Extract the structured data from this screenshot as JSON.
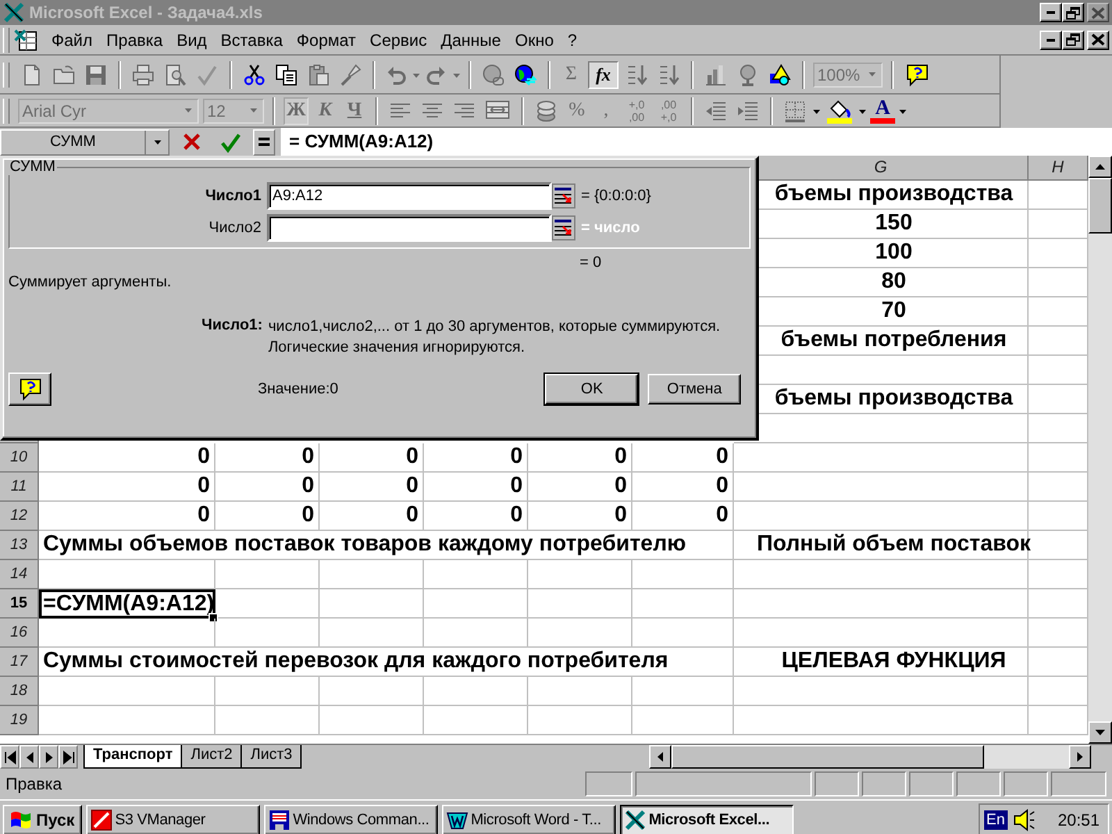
{
  "window": {
    "title": "Microsoft Excel - Задача4.xls",
    "active": false,
    "controls": [
      {
        "kind": "minimize",
        "disabled": false
      },
      {
        "kind": "restore",
        "disabled": false
      },
      {
        "kind": "close",
        "disabled": true
      }
    ]
  },
  "menu": {
    "items": [
      "Файл",
      "Правка",
      "Вид",
      "Вставка",
      "Формат",
      "Сервис",
      "Данные",
      "Окно",
      "?"
    ],
    "controls": [
      {
        "kind": "minimize",
        "disabled": false
      },
      {
        "kind": "restore",
        "disabled": false
      },
      {
        "kind": "close",
        "disabled": false
      }
    ]
  },
  "standard_toolbar": [
    {
      "kind": "new-document",
      "disabled": true
    },
    {
      "kind": "folder",
      "disabled": true
    },
    {
      "kind": "floppy-disk",
      "disabled": true
    },
    {
      "kind": "separator"
    },
    {
      "kind": "printer",
      "disabled": true
    },
    {
      "kind": "print-preview",
      "disabled": true
    },
    {
      "kind": "spellcheck",
      "disabled": true
    },
    {
      "kind": "separator"
    },
    {
      "kind": "scissors",
      "disabled": false
    },
    {
      "kind": "copy",
      "disabled": false
    },
    {
      "kind": "clipboard",
      "disabled": true
    },
    {
      "kind": "paintbrush",
      "disabled": true
    },
    {
      "kind": "separator"
    },
    {
      "kind": "undo",
      "disabled": true
    },
    {
      "kind": "caret",
      "disabled": true
    },
    {
      "kind": "redo",
      "disabled": true
    },
    {
      "kind": "caret",
      "disabled": true
    },
    {
      "kind": "separator"
    },
    {
      "kind": "globe-link",
      "disabled": true
    },
    {
      "kind": "globe",
      "disabled": false
    },
    {
      "kind": "separator"
    },
    {
      "kind": "text",
      "label": "Σ",
      "disabled": true
    },
    {
      "kind": "text",
      "label": "fx",
      "disabled": false,
      "pressed": true
    },
    {
      "kind": "sort-ascending",
      "disabled": true
    },
    {
      "kind": "sort-descending",
      "disabled": true
    },
    {
      "kind": "separator"
    },
    {
      "kind": "chart",
      "disabled": true
    },
    {
      "kind": "globe-stand",
      "disabled": true
    },
    {
      "kind": "drawing",
      "disabled": false
    },
    {
      "kind": "separator"
    },
    {
      "kind": "zoom",
      "value": "100%",
      "disabled": true
    },
    {
      "kind": "separator"
    },
    {
      "kind": "help",
      "disabled": false
    }
  ],
  "formatting_toolbar": [
    {
      "kind": "font-name",
      "value": "Arial Cyr",
      "disabled": true
    },
    {
      "kind": "font-size",
      "value": "12",
      "disabled": true
    },
    {
      "kind": "separator"
    },
    {
      "kind": "bold",
      "label": "Ж",
      "disabled": true,
      "pressed": true
    },
    {
      "kind": "italic",
      "label": "К",
      "disabled": true
    },
    {
      "kind": "underline",
      "label": "Ч",
      "disabled": true
    },
    {
      "kind": "separator"
    },
    {
      "kind": "align-left",
      "disabled": true
    },
    {
      "kind": "align-center",
      "disabled": true
    },
    {
      "kind": "align-right",
      "disabled": true
    },
    {
      "kind": "merge",
      "disabled": true
    },
    {
      "kind": "separator"
    },
    {
      "kind": "coins",
      "disabled": true
    },
    {
      "kind": "text",
      "label": "%",
      "disabled": true
    },
    {
      "kind": "text",
      "label": ",",
      "disabled": true
    },
    {
      "kind": "decimals",
      "lines": [
        "+,0",
        ",00"
      ],
      "disabled": true
    },
    {
      "kind": "decimals",
      "lines": [
        ",00",
        "+,0"
      ],
      "disabled": true
    },
    {
      "kind": "separator"
    },
    {
      "kind": "outdent",
      "disabled": true
    },
    {
      "kind": "indent",
      "disabled": true
    },
    {
      "kind": "separator"
    },
    {
      "kind": "borders",
      "disabled": true
    },
    {
      "kind": "caret",
      "disabled": false
    },
    {
      "kind": "fill-color",
      "disabled": false
    },
    {
      "kind": "caret",
      "disabled": false
    },
    {
      "kind": "font-color",
      "label": "A",
      "disabled": false
    },
    {
      "kind": "caret",
      "disabled": false
    }
  ],
  "formula_bar": {
    "name_box": "СУММ",
    "formula": "= СУММ(A9:A12)"
  },
  "sheet": {
    "columns": [
      "G",
      "H"
    ],
    "rows": [
      {
        "kind": "text",
        "cells": {
          "G": "бъемы производства"
        }
      },
      {
        "kind": "text",
        "cells": {
          "G": "150"
        }
      },
      {
        "kind": "text",
        "cells": {
          "G": "100"
        }
      },
      {
        "kind": "text",
        "cells": {
          "G": "80"
        }
      },
      {
        "kind": "text",
        "cells": {
          "G": "70"
        }
      },
      {
        "kind": "text",
        "cells": {
          "G": "бъемы потребления"
        }
      },
      {
        "kind": "blank"
      },
      {
        "kind": "text",
        "cells": {
          "G": "бъемы производства"
        }
      },
      {
        "kind": "blank"
      },
      {
        "header": "10",
        "kind": "numbers",
        "selected": false,
        "cells": {
          "A": "0",
          "B": "0",
          "C": "0",
          "D": "0",
          "E": "0",
          "F": "0"
        }
      },
      {
        "header": "11",
        "kind": "numbers",
        "selected": false,
        "cells": {
          "A": "0",
          "B": "0",
          "C": "0",
          "D": "0",
          "E": "0",
          "F": "0"
        }
      },
      {
        "header": "12",
        "kind": "numbers",
        "selected": false,
        "cells": {
          "A": "0",
          "B": "0",
          "C": "0",
          "D": "0",
          "E": "0",
          "F": "0"
        }
      },
      {
        "header": "13",
        "kind": "text",
        "selected": false,
        "cells": {
          "A": "Суммы объемов поставок товаров каждому потребителю",
          "G": "Полный объем поставок"
        }
      },
      {
        "header": "14",
        "kind": "blank",
        "selected": false
      },
      {
        "header": "15",
        "kind": "text",
        "selected": true,
        "cells": {
          "A": "=СУММ(A9:A12)"
        }
      },
      {
        "header": "16",
        "kind": "blank",
        "selected": false
      },
      {
        "header": "17",
        "kind": "text",
        "selected": false,
        "cells": {
          "A": "Суммы стоимостей перевозок для каждого потребителя",
          "G": "ЦЕЛЕВАЯ ФУНКЦИЯ"
        }
      },
      {
        "header": "18",
        "kind": "blank",
        "selected": false
      },
      {
        "header": "19",
        "kind": "blank",
        "selected": false
      }
    ]
  },
  "dialog": {
    "title": "СУММ",
    "arguments": [
      {
        "label": "Число1",
        "value": "A9:A12",
        "result": "= {0:0:0:0}",
        "selected": true,
        "dimmed": false
      },
      {
        "label": "Число2",
        "result": "= число",
        "selected": false,
        "dimmed": true
      }
    ],
    "formula_result": "= 0",
    "description": "Суммирует аргументы.",
    "argument_help": {
      "label": "Число1:",
      "lines": [
        "число1,число2,... от 1 до 30 аргументов, которые суммируются.",
        "Логические значения игнорируются."
      ]
    },
    "value": "Значение:0",
    "buttons": [
      {
        "label": "OK",
        "default": true
      },
      {
        "label": "Отмена",
        "default": false
      }
    ]
  },
  "sheet_tabs": [
    {
      "label": "Транспорт",
      "selected": true
    },
    {
      "label": "Лист2",
      "selected": false
    },
    {
      "label": "Лист3",
      "selected": false
    }
  ],
  "status_bar": {
    "text": "Правка"
  },
  "taskbar": {
    "start": "Пуск",
    "tasks": [
      {
        "kind": "red-square",
        "label": "S3 VManager",
        "selected": false
      },
      {
        "kind": "floppy-disk",
        "label": "Windows Comman...",
        "selected": false
      },
      {
        "kind": "document",
        "label": "Microsoft Word - T...",
        "selected": false
      },
      {
        "kind": "cross",
        "label": "Microsoft Excel...",
        "selected": true
      }
    ],
    "language": "En",
    "clock": "20:51"
  }
}
